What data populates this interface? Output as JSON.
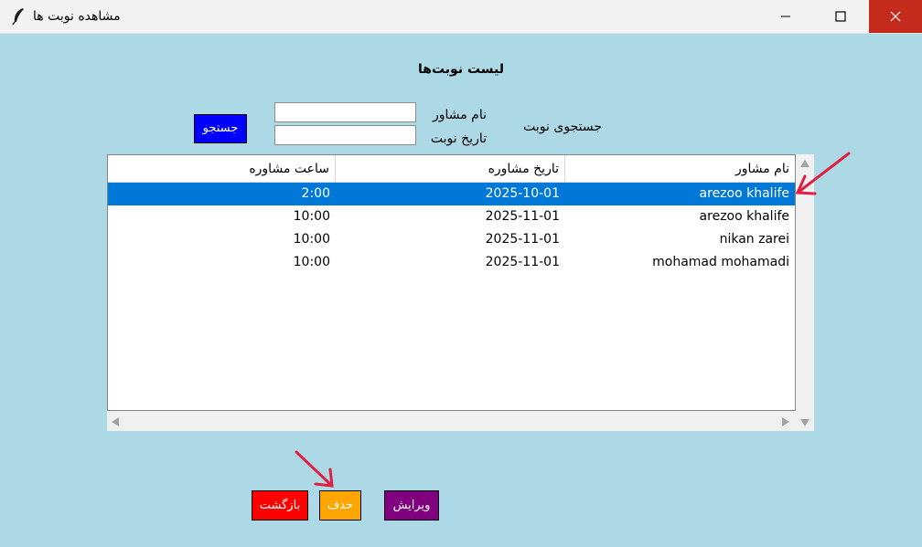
{
  "window": {
    "title": "مشاهده نوبت ها",
    "app_icon": "feather-icon",
    "controls": [
      "minimize-icon",
      "maximize-icon",
      "close-icon"
    ]
  },
  "page": {
    "heading": "لیست نوبت‌ها"
  },
  "search": {
    "section_label": "جستجوی نوبت",
    "consultant_label": "نام مشاور",
    "consultant_value": "",
    "date_label": "تاریخ نوبت",
    "date_value": "",
    "button_label": "جستجو"
  },
  "table": {
    "columns": [
      "نام مشاور",
      "تاریخ مشاوره",
      "ساعت مشاوره"
    ],
    "rows": [
      {
        "name": "arezoo khalife",
        "date": "2025-10-01",
        "time": "2:00",
        "selected": true
      },
      {
        "name": "arezoo khalife",
        "date": "2025-11-01",
        "time": "10:00",
        "selected": false
      },
      {
        "name": "nikan zarei",
        "date": "2025-11-01",
        "time": "10:00",
        "selected": false
      },
      {
        "name": "mohamad mohamadi",
        "date": "2025-11-01",
        "time": "10:00",
        "selected": false
      }
    ]
  },
  "actions": {
    "back_label": "بازگشت",
    "delete_label": "حذف",
    "edit_label": "ویرایش"
  },
  "colors": {
    "background": "#add8e6",
    "search_button": "#0000ff",
    "back_button": "#ff0000",
    "delete_button": "#ffa500",
    "edit_button": "#800080",
    "selection": "#0078d7",
    "annotation_arrow": "#e02040"
  }
}
